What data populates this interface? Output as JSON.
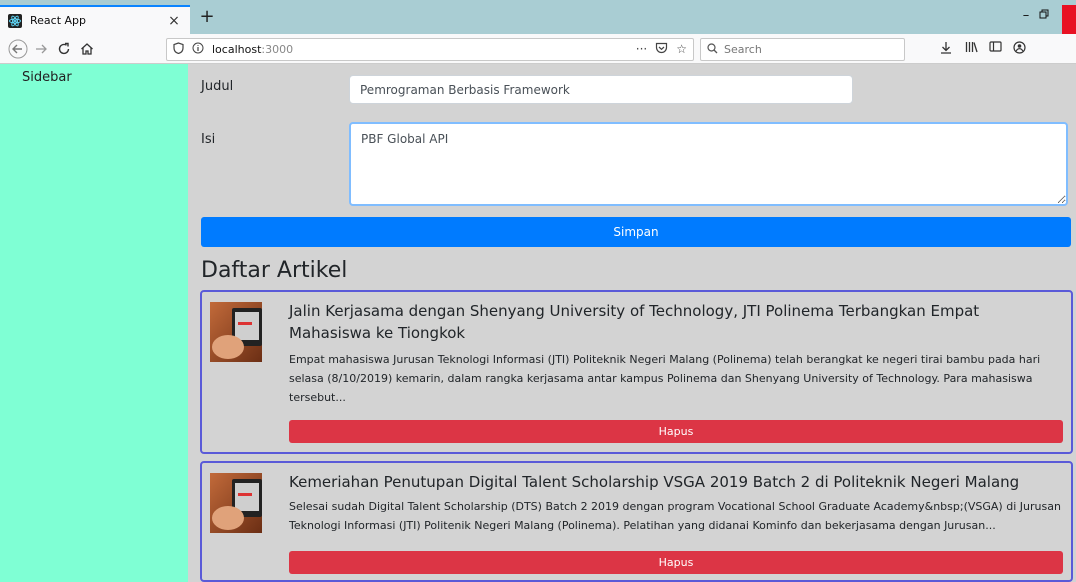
{
  "browser": {
    "tab_title": "React App",
    "url_host": "localhost",
    "url_port": ":3000",
    "search_placeholder": "Search"
  },
  "sidebar": {
    "label": "Sidebar"
  },
  "form": {
    "judul_label": "Judul",
    "judul_value": "Pemrograman Berbasis Framework",
    "isi_label": "Isi",
    "isi_value": "PBF Global API",
    "simpan_label": "Simpan"
  },
  "articles_heading": "Daftar Artikel",
  "articles": [
    {
      "title": "Jalin Kerjasama dengan Shenyang University of Technology, JTI Polinema Terbangkan Empat Mahasiswa ke Tiongkok",
      "description": "Empat mahasiswa Jurusan Teknologi Informasi (JTI) Politeknik Negeri Malang (Polinema) telah berangkat ke negeri tirai bambu pada hari selasa (8/10/2019) kemarin, dalam rangka kerjasama antar kampus Polinema dan Shenyang University of Technology. Para mahasiswa tersebut...",
      "delete_label": "Hapus"
    },
    {
      "title": "Kemeriahan Penutupan Digital Talent Scholarship VSGA 2019 Batch 2 di Politeknik Negeri Malang",
      "description": "Selesai sudah Digital Talent Scholarship (DTS) Batch 2 2019 dengan program Vocational School Graduate Academy&nbsp;(VSGA) di Jurusan Teknologi Informasi (JTI) Politenik Negeri Malang (Polinema). Pelatihan yang didanai Kominfo dan bekerjasama dengan Jurusan...",
      "delete_label": "Hapus"
    }
  ],
  "colors": {
    "sidebar_bg": "#7fffd4",
    "main_bg": "#d3d3d3",
    "primary": "#007bff",
    "danger": "#dc3545",
    "card_border": "#5a5ad8"
  },
  "icons": [
    "react-icon",
    "close-icon",
    "plus-icon",
    "minimize-icon",
    "restore-icon",
    "back-icon",
    "forward-icon",
    "reload-icon",
    "home-icon",
    "shield-icon",
    "info-icon",
    "more-icon",
    "pocket-icon",
    "star-icon",
    "search-icon",
    "download-icon",
    "library-icon",
    "sidebar-icon",
    "account-icon"
  ]
}
